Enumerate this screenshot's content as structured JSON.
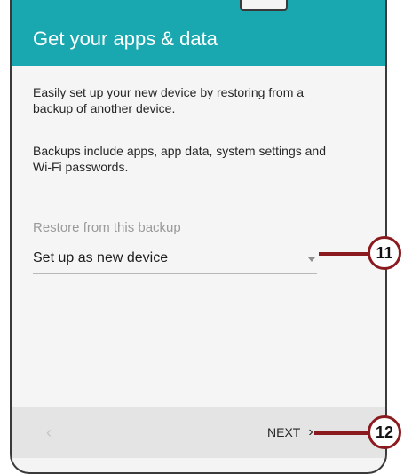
{
  "header": {
    "title": "Get your apps & data"
  },
  "content": {
    "intro_text": "Easily set up your new device by restoring from a backup of another device.",
    "backup_info_text": "Backups include apps, app data, system settings and Wi-Fi passwords.",
    "restore_label": "Restore from this backup",
    "restore_selected": "Set up as new device"
  },
  "navigation": {
    "back_icon": "chevron-left-icon",
    "next_label": "NEXT",
    "next_icon": "chevron-right-icon"
  },
  "callouts": [
    {
      "number": "11",
      "target": "restore-dropdown"
    },
    {
      "number": "12",
      "target": "next-button"
    }
  ],
  "colors": {
    "header": "#1aa8b0",
    "callout": "#8b1a1f"
  }
}
